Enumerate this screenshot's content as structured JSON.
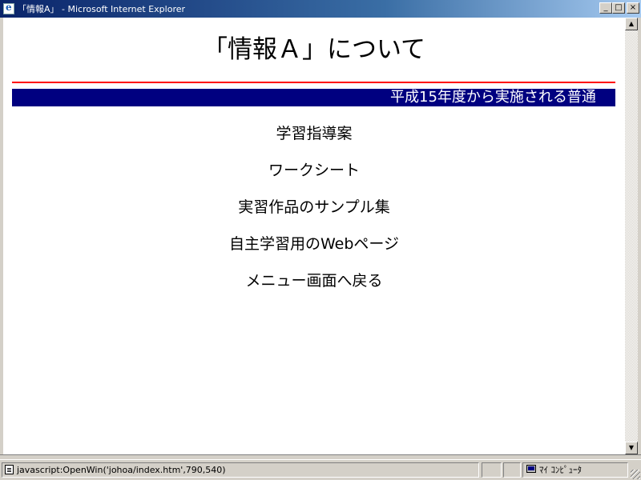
{
  "window": {
    "title": "「情報A」 - Microsoft Internet Explorer",
    "buttons": {
      "minimize": "_",
      "maximize": "□",
      "close": "×"
    }
  },
  "page": {
    "title": "「情報Ａ」について",
    "marquee": "平成15年度から実施される普通",
    "menu": [
      {
        "label": "学習指導案"
      },
      {
        "label": "ワークシート"
      },
      {
        "label": "実習作品のサンプル集"
      },
      {
        "label": "自主学習用のWebページ"
      },
      {
        "label": "メニュー画面へ戻る"
      }
    ]
  },
  "scrollbar": {
    "up": "▲",
    "down": "▼"
  },
  "statusbar": {
    "text": "javascript:OpenWin('johoa/index.htm',790,540)",
    "zone": "ﾏｲ ｺﾝﾋﾟｭｰﾀ"
  },
  "colors": {
    "title_bar_start": "#0a246a",
    "marquee_bg": "#000080",
    "rule": "#ff0000"
  }
}
